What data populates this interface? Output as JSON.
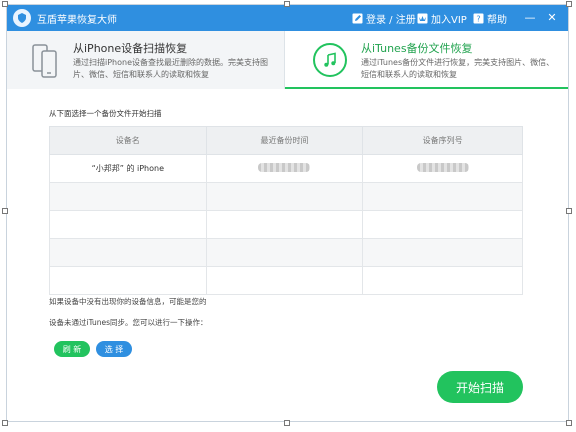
{
  "app": {
    "title": "互盾苹果恢复大师",
    "login_label": "登录 / 注册",
    "vip_label": "加入VIP",
    "help_label": "帮助",
    "minimize_glyph": "—",
    "close_glyph": "✕"
  },
  "tabs": [
    {
      "title": "从iPhone设备扫描恢复",
      "desc": "通过扫描iPhone设备查找最近删除的数据。完美支持图片、微信、短信和联系人的读取和恢复",
      "icon": "phone-icon",
      "selected": false
    },
    {
      "title": "从iTunes备份文件恢复",
      "desc": "通过iTunes备份文件进行恢复，完美支持图片、微信、短信和联系人的读取和恢复",
      "icon": "music-note-icon",
      "selected": true
    }
  ],
  "main": {
    "prompt": "从下面选择一个备份文件开始扫描",
    "columns": [
      "设备名",
      "最近备份时间",
      "设备序列号"
    ],
    "rows": [
      {
        "device": "“小邦邦” 的 iPhone",
        "time": "",
        "serial": ""
      }
    ],
    "note1": "如果设备中没有出现你的设备信息，可能是您的",
    "note2": "设备未通过iTunes同步。您可以进行一下操作：",
    "refresh_label": "刷 新",
    "select_label": "选 择",
    "start_label": "开始扫描"
  },
  "colors": {
    "titlebar": "#2f8fe0",
    "accent_green": "#22c35e",
    "accent_blue": "#2f8fe0"
  }
}
